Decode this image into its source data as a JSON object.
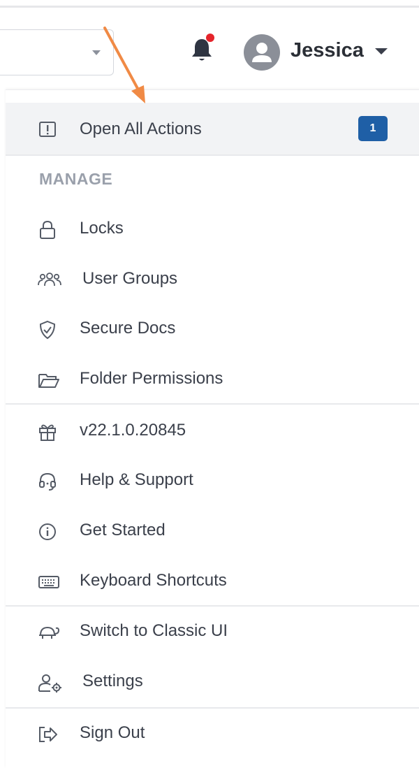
{
  "header": {
    "user_name": "Jessica",
    "notification_dot_color": "#e5242b"
  },
  "menu": {
    "open_all_actions": {
      "label": "Open All Actions",
      "badge": "1",
      "icon": "alert-square-icon"
    },
    "manage_title": "MANAGE",
    "manage_items": [
      {
        "label": "Locks",
        "icon": "lock-icon"
      },
      {
        "label": "User Groups",
        "icon": "users-icon"
      },
      {
        "label": "Secure Docs",
        "icon": "shield-check-icon"
      },
      {
        "label": "Folder Permissions",
        "icon": "folder-open-icon"
      }
    ],
    "info_items": [
      {
        "label": "v22.1.0.20845",
        "icon": "gift-icon"
      },
      {
        "label": "Help & Support",
        "icon": "headset-icon"
      },
      {
        "label": "Get Started",
        "icon": "info-circle-icon"
      },
      {
        "label": "Keyboard Shortcuts",
        "icon": "keyboard-icon"
      }
    ],
    "ui_items": [
      {
        "label": "Switch to Classic UI",
        "icon": "turtle-icon"
      },
      {
        "label": "Settings",
        "icon": "user-gear-icon"
      }
    ],
    "sign_out": {
      "label": "Sign Out",
      "icon": "sign-out-icon"
    }
  },
  "colors": {
    "accent": "#1f5fa6",
    "arrow": "#f08a45"
  }
}
